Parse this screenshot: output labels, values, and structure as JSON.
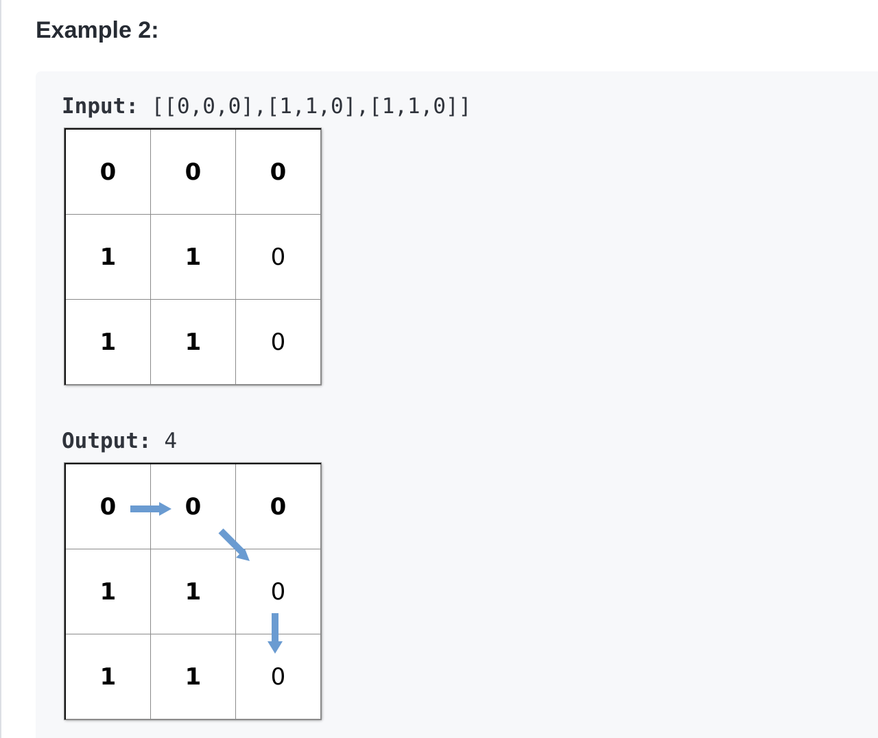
{
  "heading": "Example 2:",
  "input": {
    "label": "Input:",
    "value": " [[0,0,0],[1,1,0],[1,1,0]]",
    "grid": [
      [
        "0",
        "0",
        "0"
      ],
      [
        "1",
        "1",
        "0"
      ],
      [
        "1",
        "1",
        "0"
      ]
    ]
  },
  "output": {
    "label": "Output:",
    "value": " 4",
    "grid": [
      [
        "0",
        "0",
        "0"
      ],
      [
        "1",
        "1",
        "0"
      ],
      [
        "1",
        "1",
        "0"
      ]
    ],
    "path_arrows": [
      "right-arrow-icon",
      "diagonal-down-right-arrow-icon",
      "down-arrow-icon"
    ]
  },
  "colors": {
    "arrow": "#6a9bd1",
    "example_background": "#f7f8fa",
    "heading_text": "#262b33"
  }
}
